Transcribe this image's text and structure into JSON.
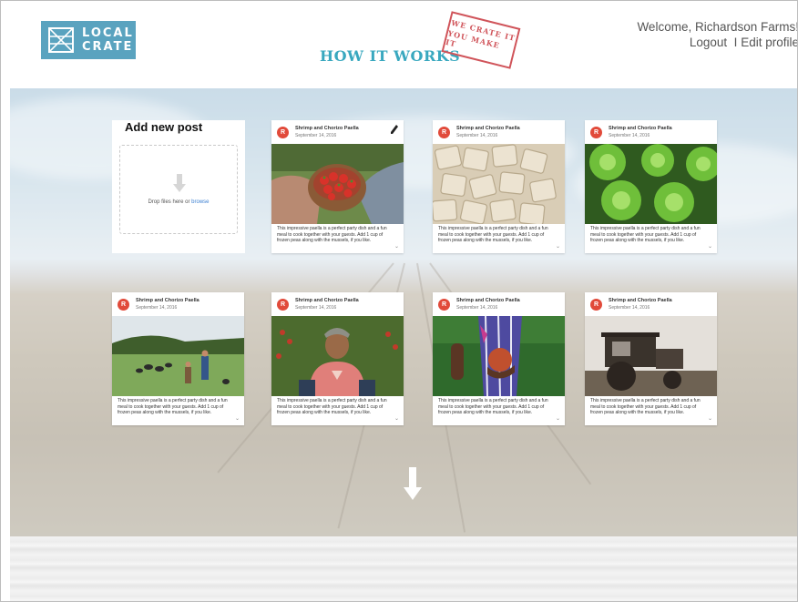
{
  "header": {
    "logo_line1": "LOCAL",
    "logo_line2": "CRATE",
    "nav_title": "HOW IT WORKS",
    "stamp_line1": "WE CRATE IT",
    "stamp_line2": "YOU MAKE IT",
    "welcome": "Welcome, Richardson Farms!",
    "logout": "Logout",
    "separator": "I",
    "edit_profile": "Edit profile"
  },
  "add_post": {
    "title": "Add new post",
    "drop_text": "Drop files here or",
    "browse": "browse"
  },
  "posts": [
    {
      "avatar": "R",
      "title": "Shrimp and Chorizo Paella",
      "date": "September 14, 2016",
      "text": "This impressive paella is a perfect party dish and a fun meal to cook together with your guests. Add 1 cup of frozen peas along with the mussels, if you like.",
      "image": "tomatoes-bowl",
      "editable": true
    },
    {
      "avatar": "R",
      "title": "Shrimp and Chorizo Paella",
      "date": "September 14, 2016",
      "text": "This impressive paella is a perfect party dish and a fun meal to cook together with your guests. Add 1 cup of frozen peas along with the mussels, if you like.",
      "image": "ravioli"
    },
    {
      "avatar": "R",
      "title": "Shrimp and Chorizo Paella",
      "date": "September 14, 2016",
      "text": "This impressive paella is a perfect party dish and a fun meal to cook together with your guests. Add 1 cup of frozen peas along with the mussels, if you like.",
      "image": "lettuce"
    },
    {
      "avatar": "R",
      "title": "Shrimp and Chorizo Paella",
      "date": "September 14, 2016",
      "text": "This impressive paella is a perfect party dish and a fun meal to cook together with your guests. Add 1 cup of frozen peas along with the mussels, if you like.",
      "image": "farm-field"
    },
    {
      "avatar": "R",
      "title": "Shrimp and Chorizo Paella",
      "date": "September 14, 2016",
      "text": "This impressive paella is a perfect party dish and a fun meal to cook together with your guests. Add 1 cup of frozen peas along with the mussels, if you like.",
      "image": "farmer-woman"
    },
    {
      "avatar": "R",
      "title": "Shrimp and Chorizo Paella",
      "date": "September 14, 2016",
      "text": "This impressive paella is a perfect party dish and a fun meal to cook together with your guests. Add 1 cup of frozen peas along with the mussels, if you like.",
      "image": "apple-hand"
    },
    {
      "avatar": "R",
      "title": "Shrimp and Chorizo Paella",
      "date": "September 14, 2016",
      "text": "This impressive paella is a perfect party dish and a fun meal to cook together with your guests. Add 1 cup of frozen peas along with the mussels, if you like.",
      "image": "tractor"
    }
  ],
  "colors": {
    "logo_bg": "#5aa3bf",
    "title_teal": "#39a8bf",
    "stamp_red": "#d0545a",
    "avatar_red": "#e14a3a",
    "link_blue": "#3b7fd1"
  },
  "icons": [
    "logo-crate-icon",
    "upload-arrow-icon",
    "edit-pencil-icon",
    "chevron-down-icon",
    "scroll-down-arrow-icon"
  ]
}
